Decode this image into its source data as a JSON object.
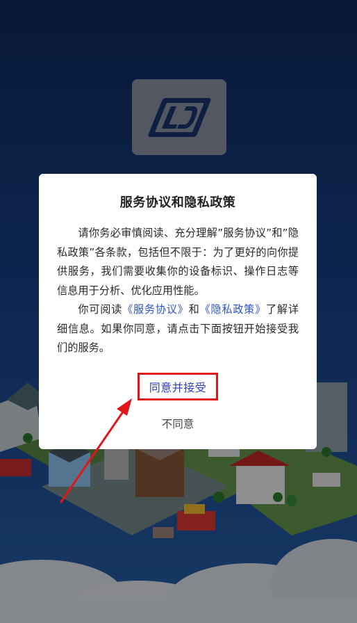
{
  "dialog": {
    "title": "服务协议和隐私政策",
    "para1": "请你务必审慎阅读、充分理解”服务协议”和”隐私政策”各条款，包括但不限于：为了更好的向你提供服务，我们需要收集你的设备标识、操作日志等信息用于分析、优化应用性能。",
    "para2_prefix": "你可阅读",
    "link_service": "《服务协议》",
    "para2_and": "和",
    "link_privacy": "《隐私政策》",
    "para2_suffix": "了解详细信息。如果你同意，请点击下面按钮开始接受我们的服务。",
    "agree_label": "同意并接受",
    "disagree_label": "不同意"
  },
  "colors": {
    "background": "#173f84",
    "link": "#2d55c9",
    "annotation_red": "#e0161b"
  },
  "icons": {
    "app_logo": "jd-logo-icon",
    "annotation": "red-arrow-icon"
  }
}
